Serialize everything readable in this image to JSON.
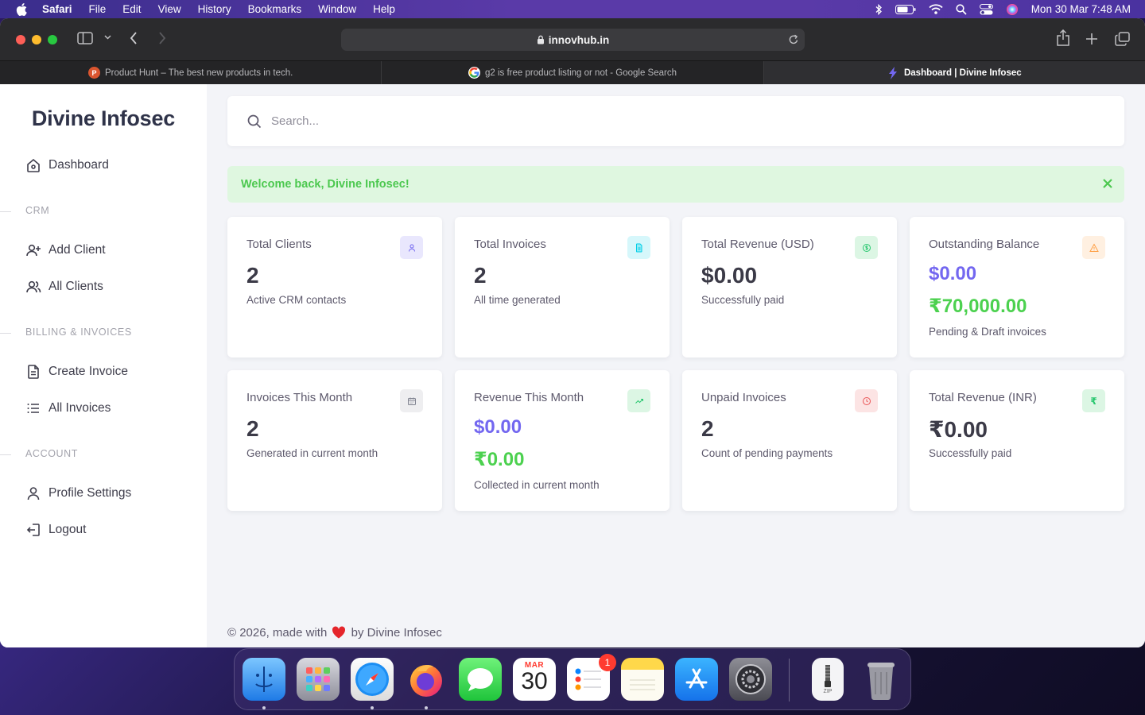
{
  "menubar": {
    "app_name": "Safari",
    "items": [
      "File",
      "Edit",
      "View",
      "History",
      "Bookmarks",
      "Window",
      "Help"
    ],
    "clock": "Mon 30 Mar  7:48 AM",
    "status_icons": [
      "bluetooth-icon",
      "battery-icon",
      "wifi-icon",
      "spotlight-search-icon",
      "control-center-icon",
      "siri-icon"
    ]
  },
  "browser": {
    "url": "innovhub.in",
    "tabs": [
      {
        "label": "Product Hunt – The best new products in tech.",
        "favicon": "P",
        "favicon_color": "#da552f",
        "active": false
      },
      {
        "label": "g2 is free product listing or not - Google Search",
        "favicon": "G",
        "favicon_color": "#ffffff",
        "active": false
      },
      {
        "label": "Dashboard | Divine Infosec",
        "favicon": "bolt",
        "favicon_color": "#7367f0",
        "active": true
      }
    ]
  },
  "sidebar": {
    "brand": "Divine Infosec",
    "dashboard": "Dashboard",
    "section_crm": "CRM",
    "add_client": "Add Client",
    "all_clients": "All Clients",
    "section_billing": "BILLING & INVOICES",
    "create_invoice": "Create Invoice",
    "all_invoices": "All Invoices",
    "section_account": "ACCOUNT",
    "profile_settings": "Profile Settings",
    "logout": "Logout"
  },
  "search": {
    "placeholder": "Search..."
  },
  "alert": {
    "message": "Welcome back, Divine Infosec!"
  },
  "cards": {
    "total_clients": {
      "title": "Total Clients",
      "value": "2",
      "sub": "Active CRM contacts"
    },
    "total_invoices": {
      "title": "Total Invoices",
      "value": "2",
      "sub": "All time generated"
    },
    "total_revenue_usd": {
      "title": "Total Revenue (USD)",
      "value": "$0.00",
      "sub": "Successfully paid"
    },
    "outstanding_balance": {
      "title": "Outstanding Balance",
      "value_usd": "$0.00",
      "value_inr": "₹70,000.00",
      "sub": "Pending & Draft invoices"
    },
    "invoices_this_month": {
      "title": "Invoices This Month",
      "value": "2",
      "sub": "Generated in current month"
    },
    "revenue_this_month": {
      "title": "Revenue This Month",
      "value_usd": "$0.00",
      "value_inr": "₹0.00",
      "sub": "Collected in current month"
    },
    "unpaid_invoices": {
      "title": "Unpaid Invoices",
      "value": "2",
      "sub": "Count of pending payments"
    },
    "total_revenue_inr": {
      "title": "Total Revenue (INR)",
      "value": "₹0.00",
      "sub": "Successfully paid"
    }
  },
  "footer": {
    "prefix": "© 2026, made with",
    "suffix": "by Divine Infosec"
  },
  "dock": {
    "apps": [
      "Finder",
      "Launchpad",
      "Safari",
      "Firefox",
      "Messages",
      "Calendar",
      "Reminders",
      "Notes",
      "App Store",
      "System Settings",
      "Archive",
      "Trash"
    ],
    "calendar_month": "MAR",
    "calendar_day": "30",
    "reminders_badge": "1",
    "archive_label": "ZIP"
  },
  "colors": {
    "primary": "#7367f0",
    "success": "#4cd14f",
    "alert_bg": "#dff7e0",
    "warning": "#ff9f43",
    "danger": "#ea5455",
    "info": "#00cfe8"
  }
}
